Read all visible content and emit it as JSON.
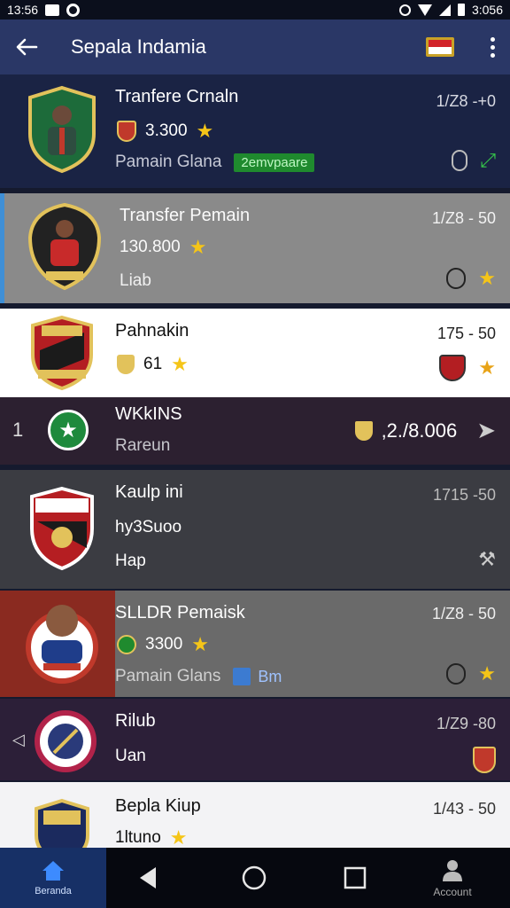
{
  "status_bar": {
    "time": "13:56",
    "right_text": "3:056"
  },
  "app_bar": {
    "title": "Sepala Indamia",
    "back_icon": "arrow-left-icon",
    "flag_icon": "flag-icon",
    "menu_icon": "more-vert-icon"
  },
  "rows": [
    {
      "name": "Tranfere Crnaln",
      "value": "3.300",
      "sub": "Pamain Glana",
      "chip": "2emvpaare",
      "date": "1/Z8 -+0",
      "bg": "#1a2344"
    },
    {
      "name": "Transfer Pemain",
      "value": "130.800",
      "sub": "Liab",
      "date": "1/Z8 - 50",
      "bg": "#8a8a8a"
    },
    {
      "name": "Pahnakin",
      "value": "61",
      "date": "175 - 50",
      "bg": "#ffffff"
    },
    {
      "index": "1",
      "name": "WKkINS",
      "sub": "Rareun",
      "amount": ",2./8.006",
      "bg": "#2c2030"
    },
    {
      "name": "Kaulp  ini",
      "value_text": "hy3Suoo",
      "sub": "Hap",
      "date": "1715 -50",
      "bg": "#3b3c42"
    },
    {
      "name": "SLLDR Pemaisk",
      "value": "3300",
      "sub": "Pamain Glans",
      "chip": "Bm",
      "date": "1/Z8 - 50",
      "bg": "#6a6a6a"
    },
    {
      "name": "Rilub",
      "sub": "Uan",
      "date": "1/Z9 -80",
      "bg": "#2c1f38"
    },
    {
      "name": "Bepla Kiup",
      "value": "1ltuno",
      "date": "1/43 - 50",
      "bg": "#f3f3f5"
    }
  ],
  "nav": {
    "home_label": "Beranda",
    "account_label": "Account"
  }
}
